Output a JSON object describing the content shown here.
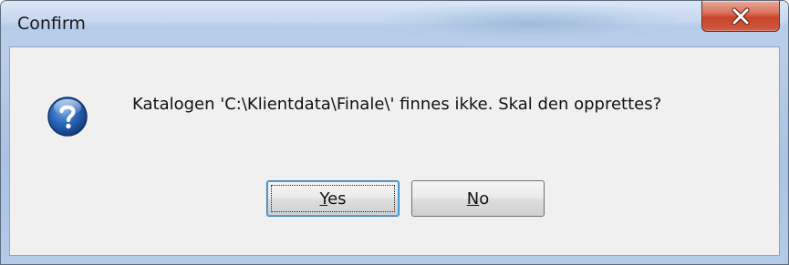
{
  "window": {
    "title": "Confirm",
    "close_icon": "close-x-icon"
  },
  "dialog": {
    "icon": "question-icon",
    "message": "Katalogen 'C:\\Klientdata\\Finale\\' finnes ikke. Skal den opprettes?"
  },
  "buttons": {
    "yes": {
      "mnemonic": "Y",
      "rest": "es"
    },
    "no": {
      "mnemonic": "N",
      "rest": "o"
    }
  },
  "colors": {
    "close_button": "#c8452a",
    "icon_blue": "#1e5aa8",
    "client_bg": "#f0f0f0"
  }
}
